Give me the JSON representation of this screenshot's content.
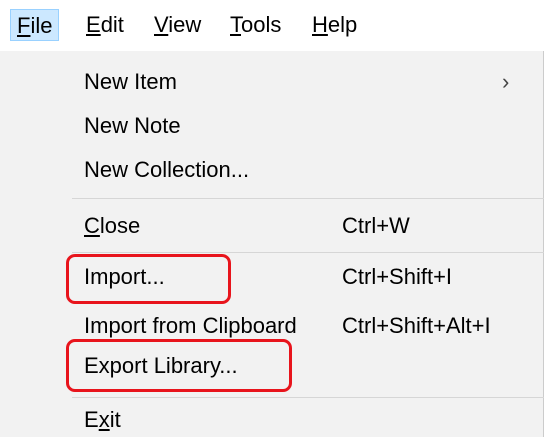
{
  "menubar": {
    "items": [
      {
        "mnemonic": "F",
        "rest": "ile"
      },
      {
        "mnemonic": "E",
        "rest": "dit"
      },
      {
        "mnemonic": "V",
        "rest": "iew"
      },
      {
        "mnemonic": "T",
        "rest": "ools"
      },
      {
        "mnemonic": "H",
        "rest": "elp"
      }
    ]
  },
  "file_menu": {
    "new_item": {
      "label": "New Item",
      "arrow": "›"
    },
    "new_note": {
      "label": "New Note"
    },
    "new_collection": {
      "label": "New Collection..."
    },
    "close": {
      "mnemonic": "C",
      "rest": "lose",
      "shortcut": "Ctrl+W"
    },
    "import": {
      "label": "Import...",
      "shortcut": "Ctrl+Shift+I"
    },
    "import_clipboard": {
      "label": "Import from Clipboard",
      "shortcut": "Ctrl+Shift+Alt+I"
    },
    "export_library": {
      "label": "Export Library..."
    },
    "exit": {
      "pre": "E",
      "mnemonic": "x",
      "rest": "it"
    }
  },
  "colors": {
    "active_menu_bg": "#cce8ff",
    "dropdown_bg": "#f2f2f2",
    "annotation_red": "#e8141c"
  }
}
